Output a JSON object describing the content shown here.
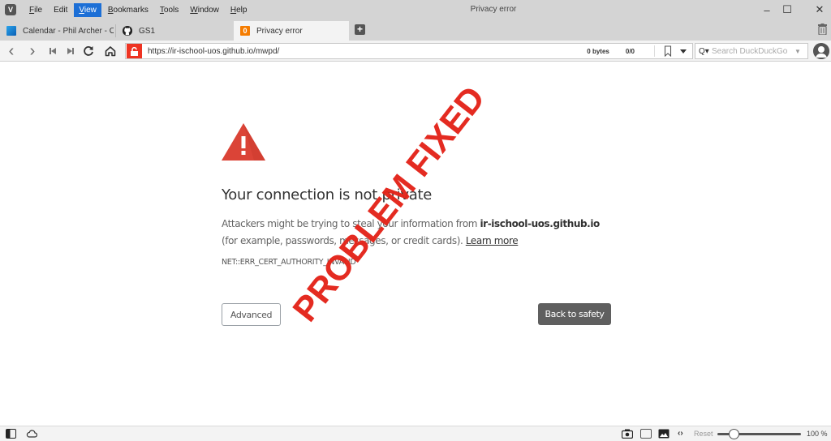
{
  "titlebar": {
    "window_title": "Privacy error",
    "menu": [
      {
        "label": "File",
        "accel": "F",
        "rest": "ile",
        "active": false
      },
      {
        "label": "Edit",
        "accel": "E",
        "rest": "dit",
        "active": false
      },
      {
        "label": "View",
        "accel": "V",
        "rest": "iew",
        "active": true
      },
      {
        "label": "Bookmarks",
        "accel": "B",
        "rest": "ookmarks",
        "active": false
      },
      {
        "label": "Tools",
        "accel": "T",
        "rest": "ools",
        "active": false
      },
      {
        "label": "Window",
        "accel": "W",
        "rest": "indow",
        "active": false
      },
      {
        "label": "Help",
        "accel": "H",
        "rest": "elp",
        "active": false
      }
    ],
    "controls": {
      "minimize": "–",
      "maximize": "☐",
      "close": "✕"
    }
  },
  "tabs": [
    {
      "label": "Calendar - Phil Archer - Out",
      "icon": "outlook-calendar-icon",
      "active": false
    },
    {
      "label": "GS1",
      "icon": "github-icon",
      "active": false
    },
    {
      "label": "Privacy error",
      "icon": "duckduckgo-icon",
      "icon_glyph": "0",
      "active": true
    }
  ],
  "new_tab_label": "+",
  "navbar": {
    "back": "‹",
    "forward": "›",
    "url": "https://ir-ischool-uos.github.io/mwpd/",
    "bytes": "0 bytes",
    "count": "0/0",
    "search_placeholder": "Search DuckDuckGo",
    "search_icon": "Q▾"
  },
  "page": {
    "headline": "Your connection is not private",
    "body_prefix": "Attackers might be trying to steal your information from ",
    "body_host": "ir-ischool-uos.github.io",
    "body_suffix": " (for example, passwords, messages, or credit cards). ",
    "learn_more": "Learn more",
    "error_code": "NET::ERR_CERT_AUTHORITY_INVALID",
    "advanced_button": "Advanced",
    "back_button": "Back to safety",
    "stamp_text": "PROBLEM FIXED",
    "accent_color": "#e4251a"
  },
  "statusbar": {
    "reset_label": "Reset",
    "zoom_value": "100 %",
    "zoom_percent": 100
  }
}
